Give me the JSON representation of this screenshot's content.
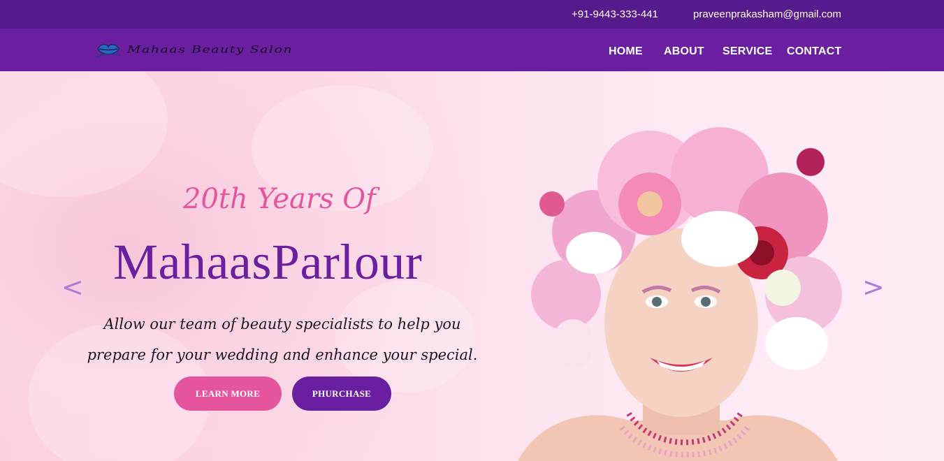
{
  "topbar": {
    "phone": "+91-9443-333-441",
    "email": "praveenprakasham@gmail.com"
  },
  "brand": {
    "name": "Mahaas Beauty Salon",
    "icon": "lips-logo-icon"
  },
  "nav": {
    "items": [
      {
        "label": "HOME"
      },
      {
        "label": "ABOUT"
      },
      {
        "label": "SERVICE"
      },
      {
        "label": "CONTACT"
      }
    ]
  },
  "hero": {
    "eyebrow": "20th Years Of",
    "headline": "MahaasParlour",
    "description": "Allow our team of beauty specialists to help you prepare for your wedding and enhance your special.",
    "buttons": {
      "learn_more": "LEARN MORE",
      "purchase": "PHURCHASE"
    },
    "prev_arrow": "<",
    "next_arrow": ">",
    "image": "woman-with-flower-headdress"
  },
  "colors": {
    "topbar": "#551b8c",
    "navbar": "#6a1fa0",
    "accent_pink": "#e5559e",
    "accent_purple": "#6a1fa0"
  }
}
